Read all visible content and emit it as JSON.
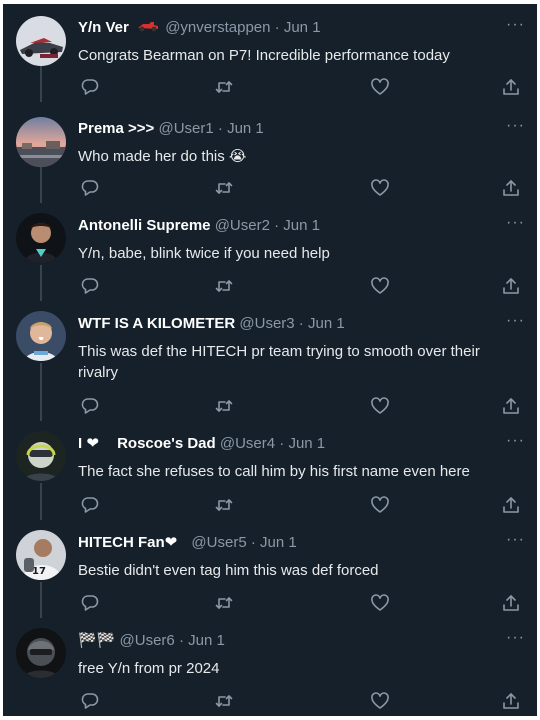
{
  "tweets": [
    {
      "name": "Y/n Ver",
      "name_icon": "race-car-icon",
      "handle": "@ynverstappen",
      "sep": " · ",
      "date": "Jun 1",
      "text": "Congrats Bearman on P7! Incredible performance today"
    },
    {
      "name": "Prema >>>",
      "handle": "@User1",
      "sep": " · ",
      "date": "Jun 1",
      "text": "Who made her do this 😭"
    },
    {
      "name": "Antonelli Supreme",
      "handle": "@User2",
      "sep": " · ",
      "date": "Jun 1",
      "text": "Y/n, babe, blink twice if you need help"
    },
    {
      "name": "WTF IS A KILOMETER",
      "handle": "@User3",
      "sep": " · ",
      "date": "Jun 1",
      "text": "This was def the HITECH pr team trying to smooth over their rivalry"
    },
    {
      "name_prefix": "I ❤",
      "name": "Roscoe's Dad",
      "handle": "@User4",
      "sep": " · ",
      "date": "Jun 1",
      "text": "The fact she refuses to call him by his first name even here"
    },
    {
      "name": "HITECH Fan❤",
      "handle": "@User5",
      "sep": " · ",
      "date": "Jun 1",
      "text": "Bestie didn't even tag him this was def forced"
    },
    {
      "name": "🏁🏁",
      "handle": "@User6",
      "sep": " · ",
      "date": "Jun 1",
      "text": "free Y/n from pr 2024"
    }
  ],
  "more_label": "···",
  "icons": {
    "reply": "reply-icon",
    "retweet": "retweet-icon",
    "like": "like-icon",
    "share": "share-icon",
    "more": "more-icon"
  },
  "colors": {
    "background": "#15202b",
    "text": "#e7e9ea",
    "secondary": "#8b98a5",
    "divider": "#38444d"
  }
}
